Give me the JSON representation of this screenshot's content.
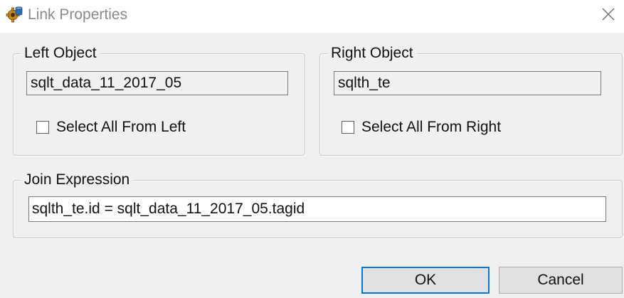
{
  "window": {
    "title": "Link Properties",
    "icon": "gear-db-icon",
    "close_icon": "close-icon"
  },
  "left_object": {
    "legend": "Left Object",
    "value": "sqlt_data_11_2017_05",
    "checkbox_label": "Select All From Left",
    "checked": false
  },
  "right_object": {
    "legend": "Right Object",
    "value": "sqlth_te",
    "checkbox_label": "Select All From Right",
    "checked": false
  },
  "join": {
    "legend": "Join Expression",
    "value": "sqlth_te.id = sqlt_data_11_2017_05.tagid"
  },
  "buttons": {
    "ok": "OK",
    "cancel": "Cancel"
  },
  "colors": {
    "accent": "#0078d7",
    "background": "#f0f0f0"
  }
}
